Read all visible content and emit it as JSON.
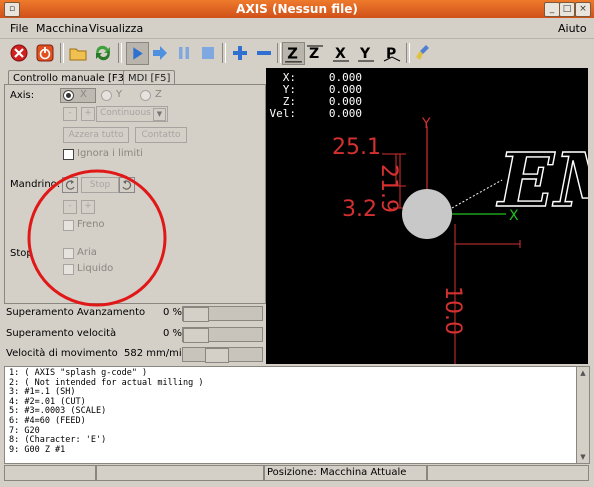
{
  "window": {
    "title": "AXIS (Nessun file)"
  },
  "menu": {
    "file": "File",
    "macchina": "Macchina",
    "visualizza": "Visualizza",
    "aiuto": "Aiuto"
  },
  "tabs": {
    "manual": "Controllo manuale [F3]",
    "mdi": "MDI [F5]"
  },
  "manual": {
    "axis_label": "Axis:",
    "axis_x": "X",
    "axis_y": "Y",
    "axis_z": "Z",
    "minus": "-",
    "plus": "+",
    "jog_mode": "Continuous",
    "zero_all": "Azzera tutto",
    "touch_off": "Contatto",
    "ignore_limits": "Ignora i limiti",
    "spindle_label": "Mandrino:",
    "stop": "Stop",
    "brake": "Freno",
    "coolant_label": "Stop",
    "mist": "Aria",
    "flood": "Liquido"
  },
  "overrides": {
    "feed_label": "Superamento Avanzamento",
    "feed_value": "0 %",
    "speed_label": "Superamento velocità",
    "speed_value": "0 %",
    "jog_label": "Velocità di movimento",
    "jog_value": "582 mm/min"
  },
  "dro": {
    "x_label": "X:",
    "x": "0.000",
    "y_label": "Y:",
    "y": "0.000",
    "z_label": "Z:",
    "z": "0.000",
    "vel_label": "Vel:",
    "vel": "0.000"
  },
  "preview": {
    "axis_y": "Y",
    "axis_x": "X",
    "dim_a": "25.1",
    "dim_b": "21.9",
    "dim_c": "3.2",
    "dim_d": "10.0",
    "text": "EM"
  },
  "gcode": [
    "1: ( AXIS \"splash g-code\" )",
    "2: ( Not intended for actual milling )",
    "3: #1=.1 (SH)",
    "4: #2=.01 (CUT)",
    "5: #3=.0003 (SCALE)",
    "6: #4=60 (FEED)",
    "7: G20",
    "8: (Character: 'E')",
    "9: G00 Z #1"
  ],
  "status": {
    "position": "Posizione: Macchina Attuale"
  },
  "colors": {
    "title_bar": "#e06a24",
    "dro_bg": "#000000",
    "dim_red": "#d33030",
    "axis_green": "#20c020",
    "annotation_circle": "#e01818"
  }
}
